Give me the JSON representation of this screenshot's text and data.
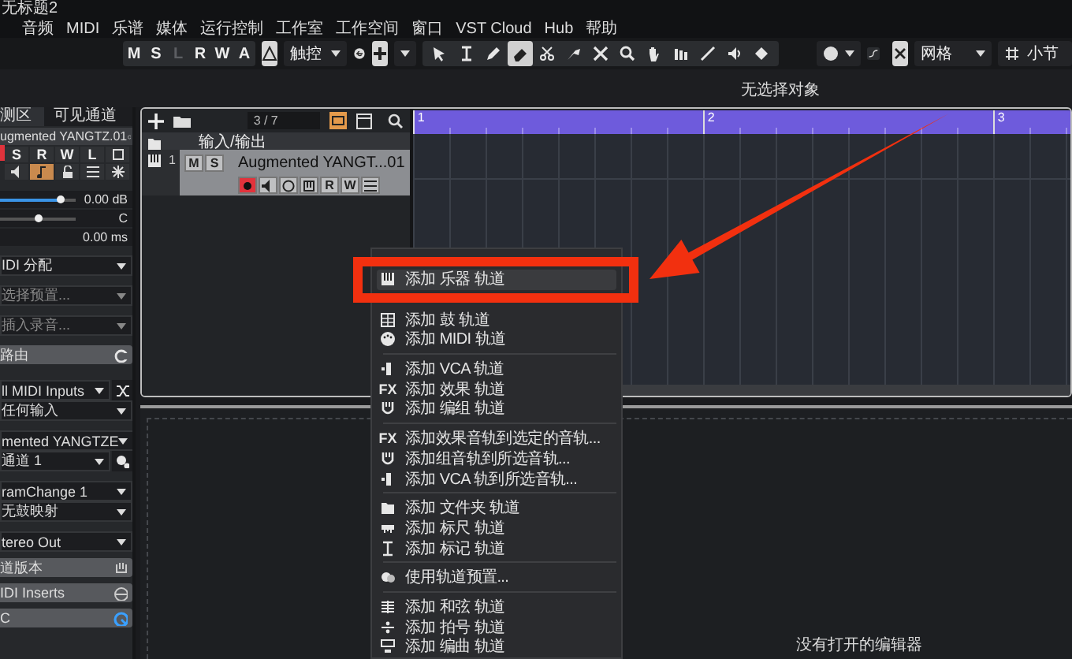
{
  "window": {
    "title": "无标题2"
  },
  "menu_bar": [
    "音频",
    "MIDI",
    "乐谱",
    "媒体",
    "运行控制",
    "工作室",
    "工作空间",
    "窗口",
    "VST Cloud",
    "Hub",
    "帮助"
  ],
  "toolbar": {
    "mode_buttons": [
      {
        "label": "M",
        "disabled": false
      },
      {
        "label": "S",
        "disabled": false
      },
      {
        "label": "L",
        "disabled": true
      },
      {
        "label": "R",
        "disabled": false
      },
      {
        "label": "W",
        "disabled": false
      },
      {
        "label": "A",
        "disabled": false
      }
    ],
    "automation_mode": "触控",
    "tools": [
      {
        "kind": "select",
        "selected": false
      },
      {
        "kind": "range",
        "selected": false
      },
      {
        "kind": "draw",
        "selected": false
      },
      {
        "kind": "erase",
        "selected": true
      },
      {
        "kind": "split",
        "selected": false
      },
      {
        "kind": "glue",
        "selected": false
      },
      {
        "kind": "mute",
        "selected": false
      },
      {
        "kind": "zoom",
        "selected": false
      },
      {
        "kind": "hand",
        "selected": false
      },
      {
        "kind": "comp",
        "selected": false
      },
      {
        "kind": "line",
        "selected": false
      },
      {
        "kind": "play",
        "selected": false
      },
      {
        "kind": "color",
        "selected": false
      }
    ],
    "snap_type": "网格",
    "grid_unit": "小节"
  },
  "info_line": "无选择对象",
  "inspector": {
    "tabs": [
      {
        "label": "测区",
        "selected": true
      },
      {
        "label": "可见通道",
        "selected": false
      }
    ],
    "track_name": "ugmented YANGTZ.01",
    "buttons": [
      "S",
      "R",
      "W",
      "L"
    ],
    "record": true,
    "monitor": true,
    "volume": {
      "level": 0.8,
      "reading": "0.00 dB"
    },
    "pan": {
      "level": 0.5,
      "reading": "C"
    },
    "delay": {
      "reading": "0.00 ms"
    },
    "groups": [
      [
        {
          "kind": "dropdown",
          "text": "IDI 分配"
        }
      ],
      [
        {
          "kind": "hint",
          "text": "选择预置..."
        }
      ],
      [
        {
          "kind": "hint",
          "text": "插入录音..."
        }
      ],
      [
        {
          "kind": "header",
          "text": "路由"
        }
      ],
      [
        {
          "kind": "dropdown",
          "text": "ll MIDI Inputs"
        },
        {
          "kind": "dropdown",
          "text": "任何输入"
        }
      ],
      [
        {
          "kind": "dropdown",
          "text": "mented YANGTZE"
        },
        {
          "kind": "dropdown",
          "text": "通道 1"
        }
      ],
      [
        {
          "kind": "dropdown",
          "text": "ramChange 1"
        },
        {
          "kind": "dropdown",
          "text": "无鼓映射"
        }
      ],
      [
        {
          "kind": "dropdown",
          "text": "tereo Out"
        }
      ],
      [
        {
          "kind": "header",
          "text": "道版本"
        },
        {
          "kind": "header",
          "text": "IDI Inserts"
        },
        {
          "kind": "header",
          "text": "C"
        }
      ]
    ]
  },
  "project": {
    "track_counter": "3 / 7",
    "tracks": [
      {
        "kind": "folder",
        "name": "输入/输出",
        "selected": false
      },
      {
        "kind": "instrument",
        "number": "1",
        "name": "Augmented YANGT...01",
        "selected": true,
        "record": true,
        "buttons": [
          "M",
          "S"
        ],
        "controls": [
          "R",
          "W"
        ]
      }
    ],
    "ruler": [
      "1",
      "2",
      "3"
    ]
  },
  "context_menu": {
    "items": [
      {
        "kind": "instrument",
        "text": "添加 乐器 轨道",
        "selected": true
      },
      {
        "kind": "covered"
      },
      {
        "kind": "drum",
        "text": "添加 鼓 轨道",
        "selected": false
      },
      {
        "kind": "midi",
        "text": "添加 MIDI 轨道",
        "selected": false
      },
      {
        "kind": "separator"
      },
      {
        "kind": "vca",
        "text": "添加 VCA 轨道",
        "selected": false
      },
      {
        "kind": "fx",
        "icon_label": "FX",
        "text": "添加 效果 轨道",
        "selected": false
      },
      {
        "kind": "group",
        "text": "添加 编组 轨道",
        "selected": false
      },
      {
        "kind": "separator"
      },
      {
        "kind": "fx",
        "icon_label": "FX",
        "text": "添加效果音轨到选定的音轨...",
        "selected": false
      },
      {
        "kind": "group",
        "text": "添加组音轨到所选音轨...",
        "selected": false
      },
      {
        "kind": "vca",
        "text": "添加 VCA 轨到所选音轨...",
        "selected": false
      },
      {
        "kind": "separator"
      },
      {
        "kind": "folder",
        "text": "添加 文件夹 轨道",
        "selected": false
      },
      {
        "kind": "ruler",
        "text": "添加 标尺 轨道",
        "selected": false
      },
      {
        "kind": "marker",
        "text": "添加 标记 轨道",
        "selected": false
      },
      {
        "kind": "separator"
      },
      {
        "kind": "preset",
        "text": "使用轨道预置...",
        "selected": false
      },
      {
        "kind": "separator"
      },
      {
        "kind": "chord",
        "text": "添加 和弦 轨道",
        "selected": false
      },
      {
        "kind": "signature",
        "text": "添加 拍号 轨道",
        "selected": false
      },
      {
        "kind": "arranger",
        "text": "添加 编曲 轨道",
        "selected": false
      }
    ]
  },
  "lower_zone": {
    "message": "没有打开的编辑器"
  }
}
